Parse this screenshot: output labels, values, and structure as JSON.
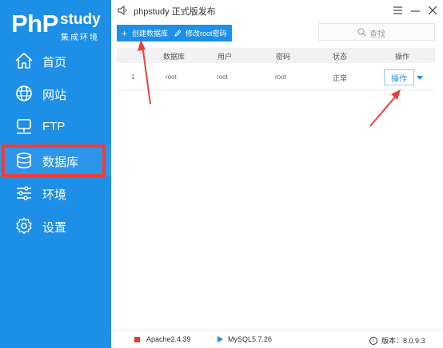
{
  "logo": {
    "php": "PhP",
    "study": "study",
    "subtitle": "集成环境"
  },
  "sidebar": {
    "items": [
      {
        "label": "首页",
        "icon": "home-icon"
      },
      {
        "label": "网站",
        "icon": "globe-icon"
      },
      {
        "label": "FTP",
        "icon": "server-icon"
      },
      {
        "label": "数据库",
        "icon": "database-icon",
        "active": true
      },
      {
        "label": "环境",
        "icon": "sliders-icon"
      },
      {
        "label": "设置",
        "icon": "gear-icon"
      }
    ]
  },
  "titlebar": {
    "title": "phpstudy 正式版发布"
  },
  "toolbar": {
    "create_db_label": "创建数据库",
    "modify_root_label": "修改root密码"
  },
  "search": {
    "placeholder": "查找"
  },
  "table": {
    "headers": [
      "数据库",
      "用户",
      "密码",
      "状态",
      "操作"
    ],
    "rows": [
      {
        "index": "1",
        "database": "root",
        "user": "root",
        "password": "root",
        "status": "正常",
        "action": "操作"
      }
    ]
  },
  "statusbar": {
    "apache": "Apache2.4.39",
    "mysql": "MySQL5.7.26",
    "version": "版本：8.0.9.3"
  },
  "colors": {
    "brand": "#1e8fe6",
    "highlight": "#e84040"
  }
}
